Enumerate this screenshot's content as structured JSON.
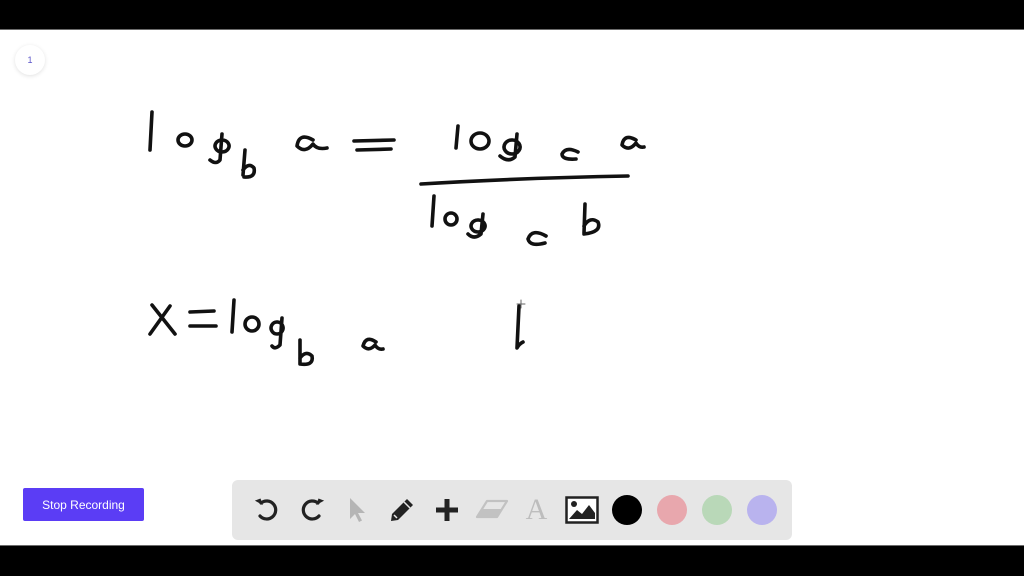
{
  "page": {
    "number": "1"
  },
  "whiteboard": {
    "equation_1": "log_b a = log_c a / log_c b",
    "equation_2": "x = log_b a",
    "partial_stroke": "l"
  },
  "recording": {
    "stop_label": "Stop Recording",
    "accent": "#5b3df5"
  },
  "toolbar": {
    "tools": [
      {
        "name": "undo",
        "icon": "undo-icon",
        "enabled": true
      },
      {
        "name": "redo",
        "icon": "redo-icon",
        "enabled": true
      },
      {
        "name": "select",
        "icon": "cursor-icon",
        "enabled": false
      },
      {
        "name": "pen",
        "icon": "pencil-icon",
        "enabled": true
      },
      {
        "name": "add",
        "icon": "plus-icon",
        "enabled": true
      },
      {
        "name": "eraser",
        "icon": "eraser-icon",
        "enabled": false
      },
      {
        "name": "text",
        "icon": "text-icon",
        "label": "A",
        "enabled": false
      },
      {
        "name": "image",
        "icon": "image-icon",
        "enabled": true
      }
    ],
    "colors": [
      {
        "name": "black",
        "hex": "#000000",
        "selected": true
      },
      {
        "name": "red",
        "hex": "#e8a7ad",
        "selected": false
      },
      {
        "name": "green",
        "hex": "#b9d8b8",
        "selected": false
      },
      {
        "name": "purple",
        "hex": "#b9b3ee",
        "selected": false
      }
    ]
  }
}
